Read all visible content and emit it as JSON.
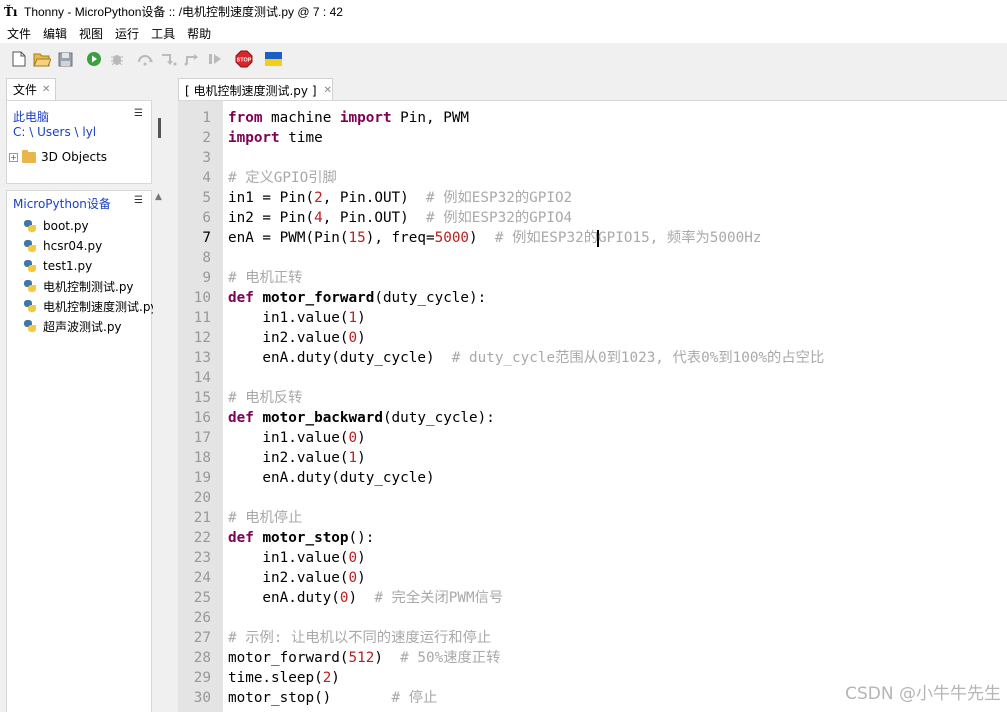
{
  "window": {
    "title": "Thonny  -  MicroPython设备 :: /电机控制速度测试.py  @  7 : 42",
    "app_icon": "Ťı"
  },
  "menu": [
    "文件",
    "编辑",
    "视图",
    "运行",
    "工具",
    "帮助"
  ],
  "toolbar": {
    "buttons": [
      "new-file-icon",
      "open-file-icon",
      "save-icon",
      "run-icon",
      "debug-icon",
      "step-over-icon",
      "step-into-icon",
      "step-out-icon",
      "resume-icon",
      "stop-icon",
      "ukraine-flag-icon"
    ],
    "stop_label": "STOP"
  },
  "files_panel": {
    "tab_label": "文件",
    "local": {
      "header": "此电脑",
      "path": "C: \\ Users \\ lyl",
      "items": [
        {
          "label": "3D Objects"
        }
      ]
    },
    "device": {
      "header": "MicroPython设备",
      "files": [
        "boot.py",
        "hcsr04.py",
        "test1.py",
        "电机控制测试.py",
        "电机控制速度测试.py",
        "超声波测试.py"
      ]
    }
  },
  "editor": {
    "tab_label": "[ 电机控制速度测试.py ]",
    "current_line": 7,
    "lines": [
      [
        [
          "kw",
          "from"
        ],
        [
          "t",
          " machine "
        ],
        [
          "kw",
          "import"
        ],
        [
          "t",
          " Pin, PWM"
        ]
      ],
      [
        [
          "kw",
          "import"
        ],
        [
          "t",
          " time"
        ]
      ],
      [],
      [
        [
          "cm",
          "# 定义GPIO引脚"
        ]
      ],
      [
        [
          "t",
          "in1 = Pin("
        ],
        [
          "num",
          "2"
        ],
        [
          "t",
          ", Pin.OUT)  "
        ],
        [
          "cm",
          "# 例如ESP32的GPIO2"
        ]
      ],
      [
        [
          "t",
          "in2 = Pin("
        ],
        [
          "num",
          "4"
        ],
        [
          "t",
          ", Pin.OUT)  "
        ],
        [
          "cm",
          "# 例如ESP32的GPIO4"
        ]
      ],
      [
        [
          "t",
          "enA = PWM(Pin("
        ],
        [
          "num",
          "15"
        ],
        [
          "t",
          "), freq="
        ],
        [
          "num",
          "5000"
        ],
        [
          "t",
          ")  "
        ],
        [
          "cm",
          "# 例如ESP32的"
        ],
        [
          "caret",
          ""
        ],
        [
          "cm",
          "GPIO15, 频率为5000Hz"
        ]
      ],
      [],
      [
        [
          "cm",
          "# 电机正转"
        ]
      ],
      [
        [
          "kw",
          "def"
        ],
        [
          "t",
          " "
        ],
        [
          "fn",
          "motor_forward"
        ],
        [
          "t",
          "(duty_cycle):"
        ]
      ],
      [
        [
          "t",
          "    in1.value("
        ],
        [
          "num",
          "1"
        ],
        [
          "t",
          ")"
        ]
      ],
      [
        [
          "t",
          "    in2.value("
        ],
        [
          "num",
          "0"
        ],
        [
          "t",
          ")"
        ]
      ],
      [
        [
          "t",
          "    enA.duty(duty_cycle)  "
        ],
        [
          "cm",
          "# duty_cycle范围从0到1023, 代表0%到100%的占空比"
        ]
      ],
      [],
      [
        [
          "cm",
          "# 电机反转"
        ]
      ],
      [
        [
          "kw",
          "def"
        ],
        [
          "t",
          " "
        ],
        [
          "fn",
          "motor_backward"
        ],
        [
          "t",
          "(duty_cycle):"
        ]
      ],
      [
        [
          "t",
          "    in1.value("
        ],
        [
          "num",
          "0"
        ],
        [
          "t",
          ")"
        ]
      ],
      [
        [
          "t",
          "    in2.value("
        ],
        [
          "num",
          "1"
        ],
        [
          "t",
          ")"
        ]
      ],
      [
        [
          "t",
          "    enA.duty(duty_cycle)"
        ]
      ],
      [],
      [
        [
          "cm",
          "# 电机停止"
        ]
      ],
      [
        [
          "kw",
          "def"
        ],
        [
          "t",
          " "
        ],
        [
          "fn",
          "motor_stop"
        ],
        [
          "t",
          "():"
        ]
      ],
      [
        [
          "t",
          "    in1.value("
        ],
        [
          "num",
          "0"
        ],
        [
          "t",
          ")"
        ]
      ],
      [
        [
          "t",
          "    in2.value("
        ],
        [
          "num",
          "0"
        ],
        [
          "t",
          ")"
        ]
      ],
      [
        [
          "t",
          "    enA.duty("
        ],
        [
          "num",
          "0"
        ],
        [
          "t",
          ")  "
        ],
        [
          "cm",
          "# 完全关闭PWM信号"
        ]
      ],
      [],
      [
        [
          "cm",
          "# 示例: 让电机以不同的速度运行和停止"
        ]
      ],
      [
        [
          "t",
          "motor_forward("
        ],
        [
          "num",
          "512"
        ],
        [
          "t",
          ")  "
        ],
        [
          "cm",
          "# 50%速度正转"
        ]
      ],
      [
        [
          "t",
          "time.sleep("
        ],
        [
          "num",
          "2"
        ],
        [
          "t",
          ")"
        ]
      ],
      [
        [
          "t",
          "motor_stop()       "
        ],
        [
          "cm",
          "# 停止"
        ]
      ]
    ]
  },
  "watermark": "CSDN @小牛牛先生"
}
